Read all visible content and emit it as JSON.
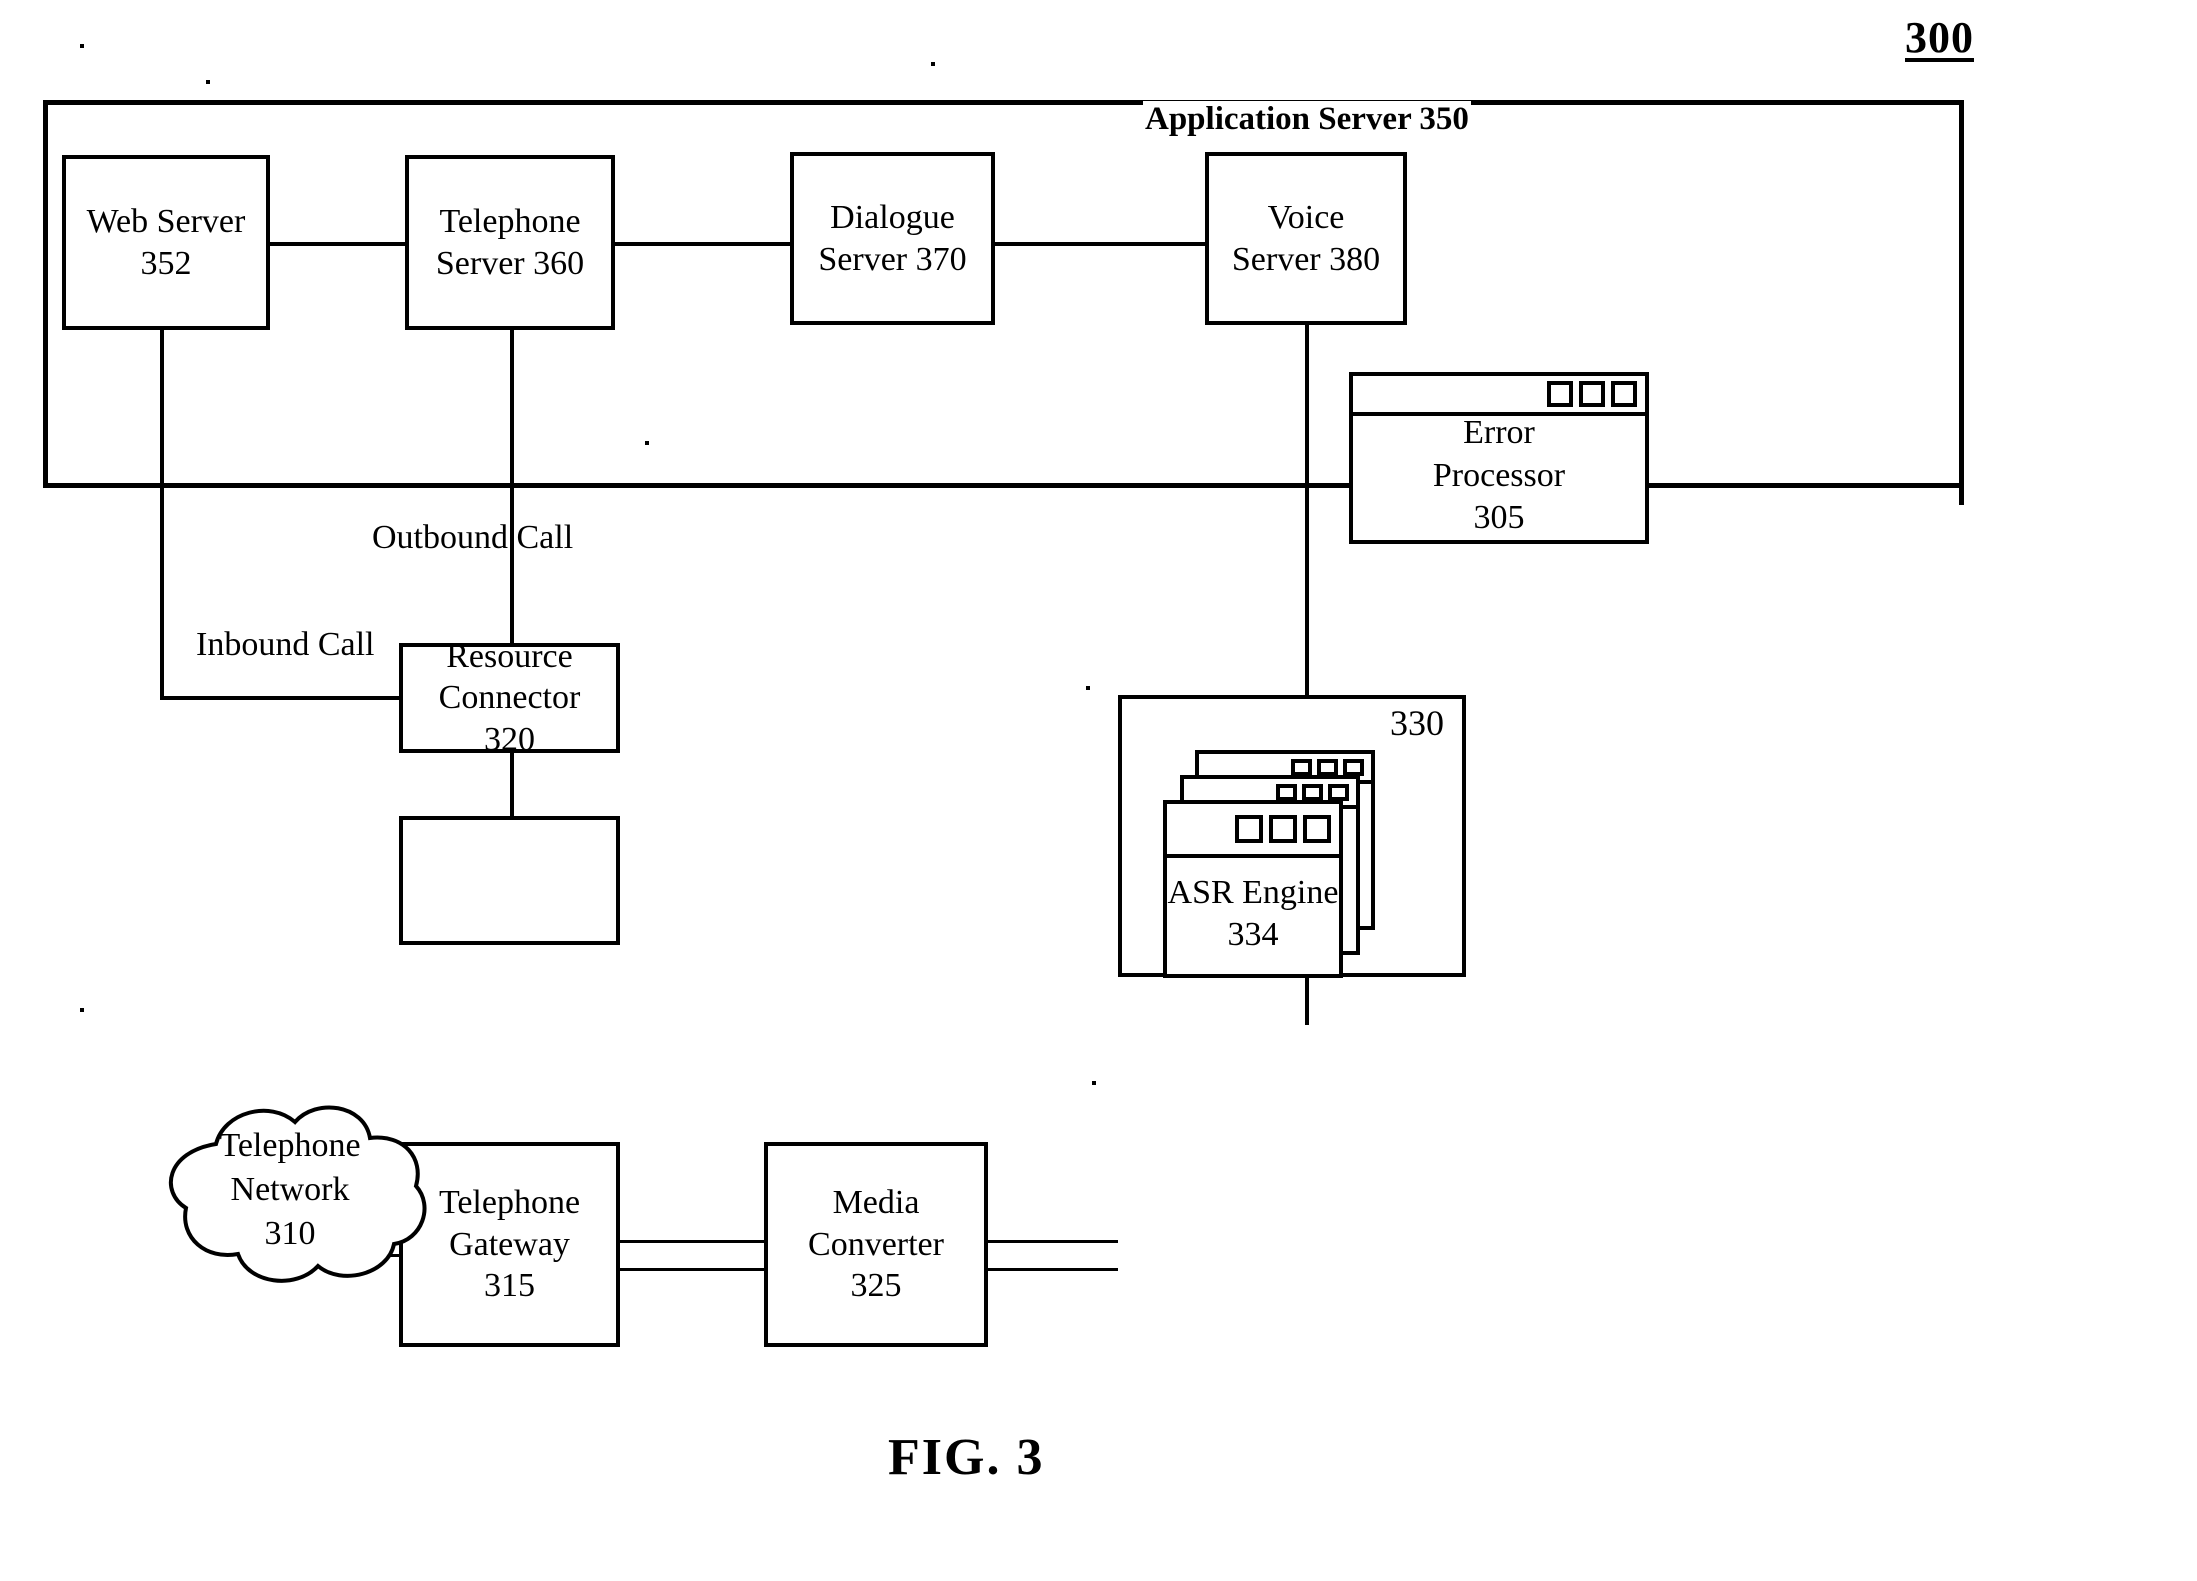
{
  "figure": {
    "number": "300",
    "caption": "FIG. 3"
  },
  "application_server": {
    "label": "Application Server 350"
  },
  "nodes": {
    "web_server": {
      "line1": "Web Server",
      "line2": "352"
    },
    "telephone_server": {
      "line1": "Telephone",
      "line2": "Server 360"
    },
    "dialogue_server": {
      "line1": "Dialogue",
      "line2": "Server 370"
    },
    "voice_server": {
      "line1": "Voice",
      "line2": "Server 380"
    },
    "error_processor": {
      "line1": "Error",
      "line2": "Processor",
      "line3": "305"
    },
    "resource_connector": {
      "line1": "Resource",
      "line2": "Connector",
      "line3": "320"
    },
    "telephone_network": {
      "line1": "Telephone",
      "line2": "Network",
      "line3": "310"
    },
    "telephone_gateway": {
      "line1": "Telephone",
      "line2": "Gateway",
      "line3": "315"
    },
    "media_converter": {
      "line1": "Media",
      "line2": "Converter",
      "line3": "325"
    },
    "asr_engine": {
      "line1": "ASR Engine",
      "line2": "334"
    },
    "asr_container": {
      "label": "330"
    }
  },
  "edge_labels": {
    "outbound": {
      "line1": "Outbound",
      "line2": "Call"
    },
    "inbound": {
      "line1": "Inbound",
      "line2": "Call"
    }
  },
  "colors": {
    "stroke": "#000000",
    "background": "#ffffff"
  }
}
